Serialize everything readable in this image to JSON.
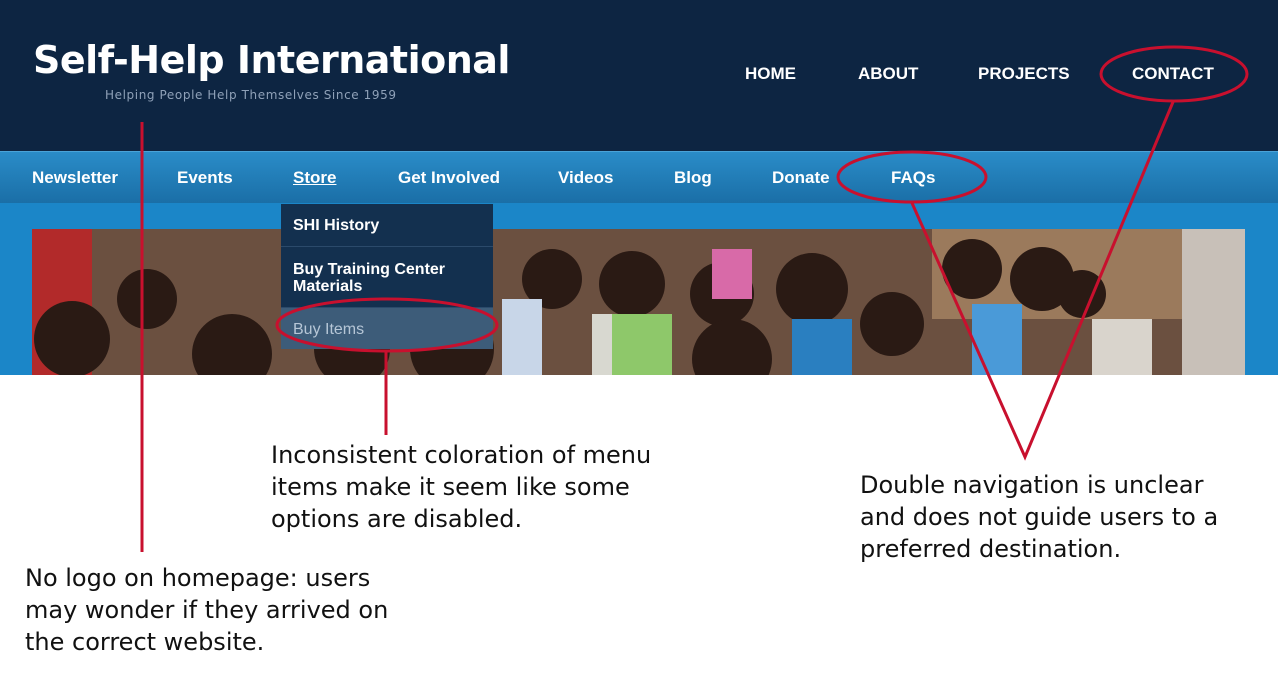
{
  "header": {
    "title": "Self-Help International",
    "tagline": "Helping People Help Themselves Since 1959",
    "nav": [
      {
        "label": "HOME"
      },
      {
        "label": "ABOUT"
      },
      {
        "label": "PROJECTS"
      },
      {
        "label": "CONTACT"
      }
    ]
  },
  "subnav": {
    "items": [
      {
        "label": "Newsletter"
      },
      {
        "label": "Events"
      },
      {
        "label": "Store"
      },
      {
        "label": "Get Involved"
      },
      {
        "label": "Videos"
      },
      {
        "label": "Blog"
      },
      {
        "label": "Donate"
      },
      {
        "label": "FAQs"
      }
    ],
    "active": "Store"
  },
  "dropdown": {
    "items": [
      {
        "label": "SHI History"
      },
      {
        "label": "Buy Training Center Materials"
      },
      {
        "label": "Buy Items"
      }
    ]
  },
  "annotations": {
    "logo_note": "No logo on homepage: users may wonder if they arrived on the correct website.",
    "color_note": "Inconsistent coloration of menu items make it seem like some options are disabled.",
    "nav_note": "Double navigation is unclear and does not guide users to a preferred destination."
  },
  "colors": {
    "header_bg": "#0d2542",
    "subnav_bg": "#1a7ab8",
    "hero_band": "#1b86c8",
    "dropdown_bg": "#13304f",
    "annotation_red": "#c8102e"
  }
}
